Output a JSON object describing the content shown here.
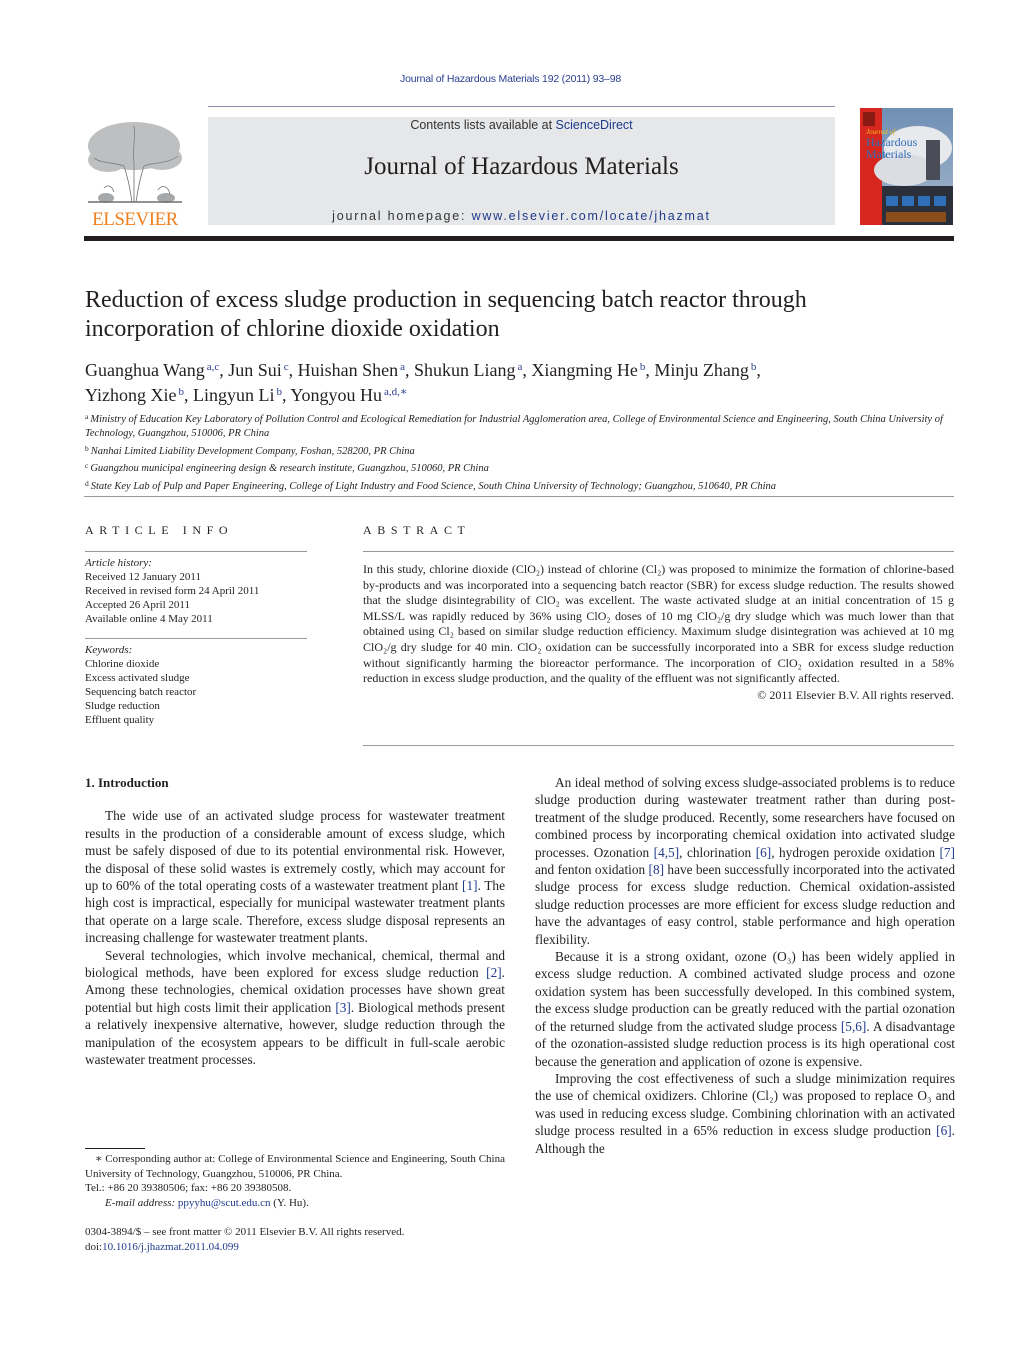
{
  "running_header": "Journal of Hazardous Materials 192 (2011) 93–98",
  "masthead": {
    "publisher_logo_text": "ELSEVIER",
    "contents_prefix": "Contents lists available at ",
    "contents_link": "ScienceDirect",
    "journal_title": "Journal of Hazardous Materials",
    "homepage_prefix": "journal homepage: ",
    "homepage_link": "www.elsevier.com/locate/jhazmat",
    "cover_lines": [
      "Journal of",
      "Hazardous",
      "Materials"
    ],
    "colors": {
      "elsevier_orange": "#f07f1e",
      "link_blue": "#1f3a8a",
      "cover_red": "#d7261e"
    }
  },
  "article": {
    "title_line1": "Reduction of excess sludge production in sequencing batch reactor through",
    "title_line2": "incorporation of chlorine dioxide oxidation",
    "authors": [
      {
        "name": "Guanghua Wang",
        "aff": "a,c"
      },
      {
        "name": "Jun Sui",
        "aff": "c"
      },
      {
        "name": "Huishan Shen",
        "aff": "a"
      },
      {
        "name": "Shukun Liang",
        "aff": "a"
      },
      {
        "name": "Xiangming He",
        "aff": "b"
      },
      {
        "name": "Minju Zhang",
        "aff": "b"
      },
      {
        "name": "Yizhong Xie",
        "aff": "b"
      },
      {
        "name": "Lingyun Li",
        "aff": "b"
      },
      {
        "name": "Yongyou Hu",
        "aff": "a,d,∗"
      }
    ],
    "affiliations": [
      {
        "key": "a",
        "text": "Ministry of Education Key Laboratory of Pollution Control and Ecological Remediation for Industrial Agglomeration area, College of Environmental Science and Engineering, South China University of Technology, Guangzhou, 510006, PR China"
      },
      {
        "key": "b",
        "text": "Nanhai Limited Liability Development Company, Foshan, 528200, PR China"
      },
      {
        "key": "c",
        "text": "Guangzhou municipal engineering design & research institute, Guangzhou, 510060, PR China"
      },
      {
        "key": "d",
        "text": "State Key Lab of Pulp and Paper Engineering, College of Light Industry and Food Science, South China University of Technology; Guangzhou, 510640, PR China"
      }
    ]
  },
  "article_info": {
    "heading": "ARTICLE INFO",
    "history_label": "Article history:",
    "history": [
      "Received 12 January 2011",
      "Received in revised form 24 April 2011",
      "Accepted 26 April 2011",
      "Available online 4 May 2011"
    ],
    "keywords_label": "Keywords:",
    "keywords": [
      "Chlorine dioxide",
      "Excess activated sludge",
      "Sequencing batch reactor",
      "Sludge reduction",
      "Effluent quality"
    ]
  },
  "abstract": {
    "heading": "ABSTRACT",
    "text": "In this study, chlorine dioxide (ClO₂) instead of chlorine (Cl₂) was proposed to minimize the formation of chlorine-based by-products and was incorporated into a sequencing batch reactor (SBR) for excess sludge reduction. The results showed that the sludge disintegrability of ClO₂ was excellent. The waste activated sludge at an initial concentration of 15 g MLSS/L was rapidly reduced by 36% using ClO₂ doses of 10 mg ClO₂/g dry sludge which was much lower than that obtained using Cl₂ based on similar sludge reduction efficiency. Maximum sludge disintegration was achieved at 10 mg ClO₂/g dry sludge for 40 min. ClO₂ oxidation can be successfully incorporated into a SBR for excess sludge reduction without significantly harming the bioreactor performance. The incorporation of ClO₂ oxidation resulted in a 58% reduction in excess sludge production, and the quality of the effluent was not significantly affected.",
    "copyright": "© 2011 Elsevier B.V. All rights reserved."
  },
  "body": {
    "section_heading": "1.  Introduction",
    "left_paragraphs": [
      {
        "segments": [
          {
            "t": "The wide use of an activated sludge process for wastewater treatment results in the production of a considerable amount of excess sludge, which must be safely disposed of due to its potential environmental risk. However, the disposal of these solid wastes is extremely costly, which may account for up to 60% of the total operating costs of a wastewater treatment plant "
          },
          {
            "ref": "[1]"
          },
          {
            "t": ". The high cost is impractical, especially for municipal wastewater treatment plants that operate on a large scale. Therefore, excess sludge disposal represents an increasing challenge for wastewater treatment plants."
          }
        ]
      },
      {
        "segments": [
          {
            "t": "Several technologies, which involve mechanical, chemical, thermal and biological methods, have been explored for excess sludge reduction "
          },
          {
            "ref": "[2]"
          },
          {
            "t": ". Among these technologies, chemical oxidation processes have shown great potential but high costs limit their application "
          },
          {
            "ref": "[3]"
          },
          {
            "t": ". Biological methods present a relatively inexpensive alternative, however, sludge reduction through the manipulation of the ecosystem appears to be difficult in full-scale aerobic wastewater treatment processes."
          }
        ]
      }
    ],
    "right_paragraphs": [
      {
        "segments": [
          {
            "t": "An ideal method of solving excess sludge-associated problems is to reduce sludge production during wastewater treatment rather than during post-treatment of the sludge produced. Recently, some researchers have focused on combined process by incorporating chemical oxidation into activated sludge processes. Ozonation "
          },
          {
            "ref": "[4,5]"
          },
          {
            "t": ", chlorination "
          },
          {
            "ref": "[6]"
          },
          {
            "t": ", hydrogen peroxide oxidation "
          },
          {
            "ref": "[7]"
          },
          {
            "t": " and fenton oxidation "
          },
          {
            "ref": "[8]"
          },
          {
            "t": " have been successfully incorporated into the activated sludge process for excess sludge reduction. Chemical oxidation-assisted sludge reduction processes are more efficient for excess sludge reduction and have the advantages of easy control, stable performance and high operation flexibility."
          }
        ]
      },
      {
        "segments": [
          {
            "t": "Because it is a strong oxidant, ozone (O₃) has been widely applied in excess sludge reduction. A combined activated sludge process and ozone oxidation system has been successfully developed. In this combined system, the excess sludge production can be greatly reduced with the partial ozonation of the returned sludge from the activated sludge process "
          },
          {
            "ref": "[5,6]"
          },
          {
            "t": ". A disadvantage of the ozonation-assisted sludge reduction process is its high operational cost because the generation and application of ozone is expensive."
          }
        ]
      },
      {
        "segments": [
          {
            "t": "Improving the cost effectiveness of such a sludge minimization requires the use of chemical oxidizers. Chlorine (Cl₂) was proposed to replace O₃ and was used in reducing excess sludge. Combining chlorination with an activated sludge process resulted in a 65% reduction in excess sludge production "
          },
          {
            "ref": "[6]"
          },
          {
            "t": ". Although the"
          }
        ]
      }
    ]
  },
  "footnotes": {
    "corresponding": "∗ Corresponding author at: College of Environmental Science and Engineering, South China University of Technology, Guangzhou, 510006, PR China.",
    "tel": "Tel.: +86 20 39380506; fax: +86 20 39380508.",
    "email_label": "E-mail address: ",
    "email": "ppyyhu@scut.edu.cn",
    "email_suffix": " (Y. Hu).",
    "issn": "0304-3894/$ – see front matter © 2011 Elsevier B.V. All rights reserved.",
    "doi_prefix": "doi:",
    "doi": "10.1016/j.jhazmat.2011.04.099"
  }
}
